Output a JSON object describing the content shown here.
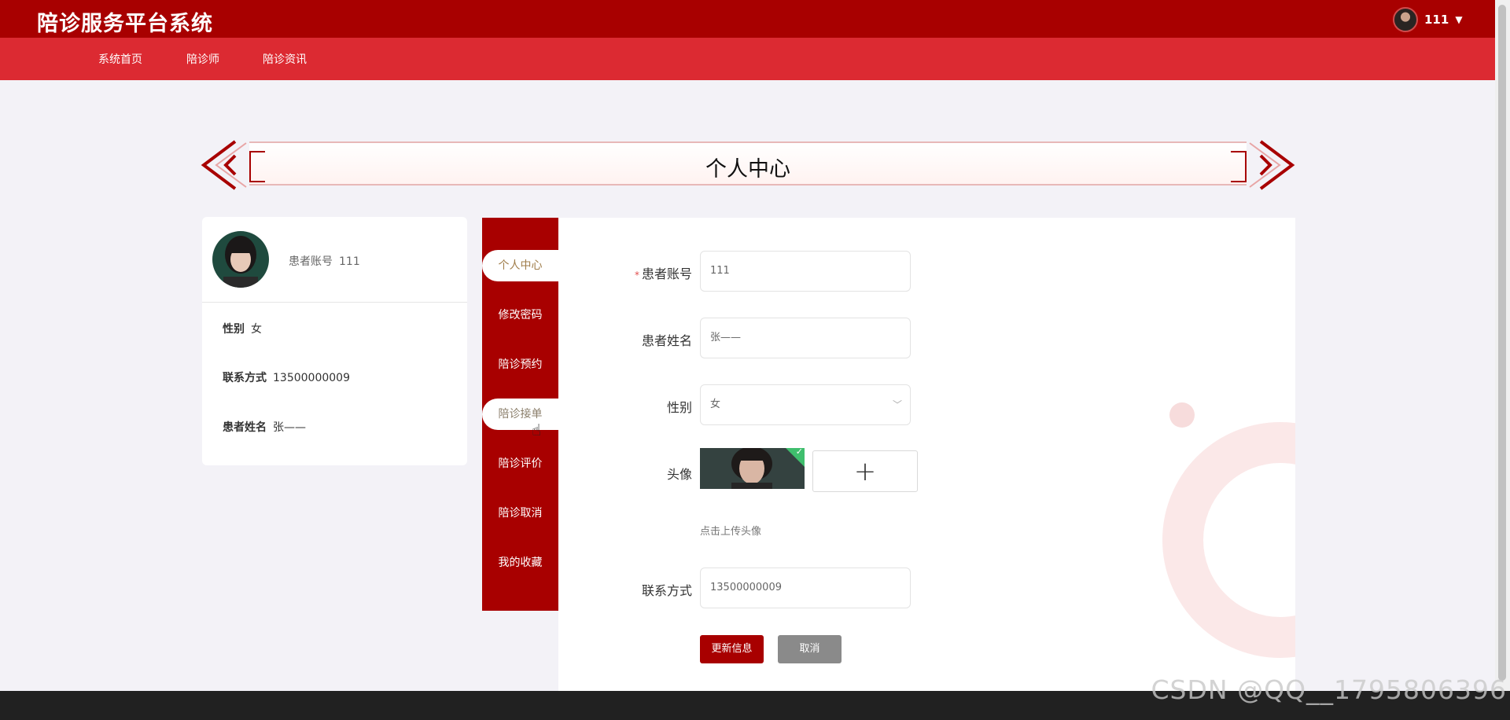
{
  "header": {
    "brand": "陪诊服务平台系统",
    "username": "111"
  },
  "nav": {
    "items": [
      "系统首页",
      "陪诊师",
      "陪诊资讯"
    ]
  },
  "banner": {
    "title": "个人中心"
  },
  "profile_card": {
    "account_label": "患者账号",
    "account_value": "111",
    "rows": [
      {
        "label": "性别",
        "value": "女"
      },
      {
        "label": "联系方式",
        "value": "13500000009"
      },
      {
        "label": "患者姓名",
        "value": "张——"
      }
    ]
  },
  "side_menu": {
    "items": [
      "个人中心",
      "修改密码",
      "陪诊预约",
      "陪诊接单",
      "陪诊评价",
      "陪诊取消",
      "我的收藏"
    ],
    "active_index": 0
  },
  "form": {
    "account": {
      "label": "患者账号",
      "value": "111"
    },
    "name": {
      "label": "患者姓名",
      "value": "张——"
    },
    "gender": {
      "label": "性别",
      "value": "女"
    },
    "avatar": {
      "label": "头像",
      "add_symbol": "+",
      "tip": "点击上传头像"
    },
    "phone": {
      "label": "联系方式",
      "value": "13500000009"
    },
    "submit_label": "更新信息",
    "cancel_label": "取消"
  },
  "watermark": "CSDN @QQ__1795806396",
  "colors": {
    "primary": "#a80000",
    "nav": "#dc2a32",
    "background": "#f3f2f7",
    "accent_text": "#a07d4a"
  }
}
